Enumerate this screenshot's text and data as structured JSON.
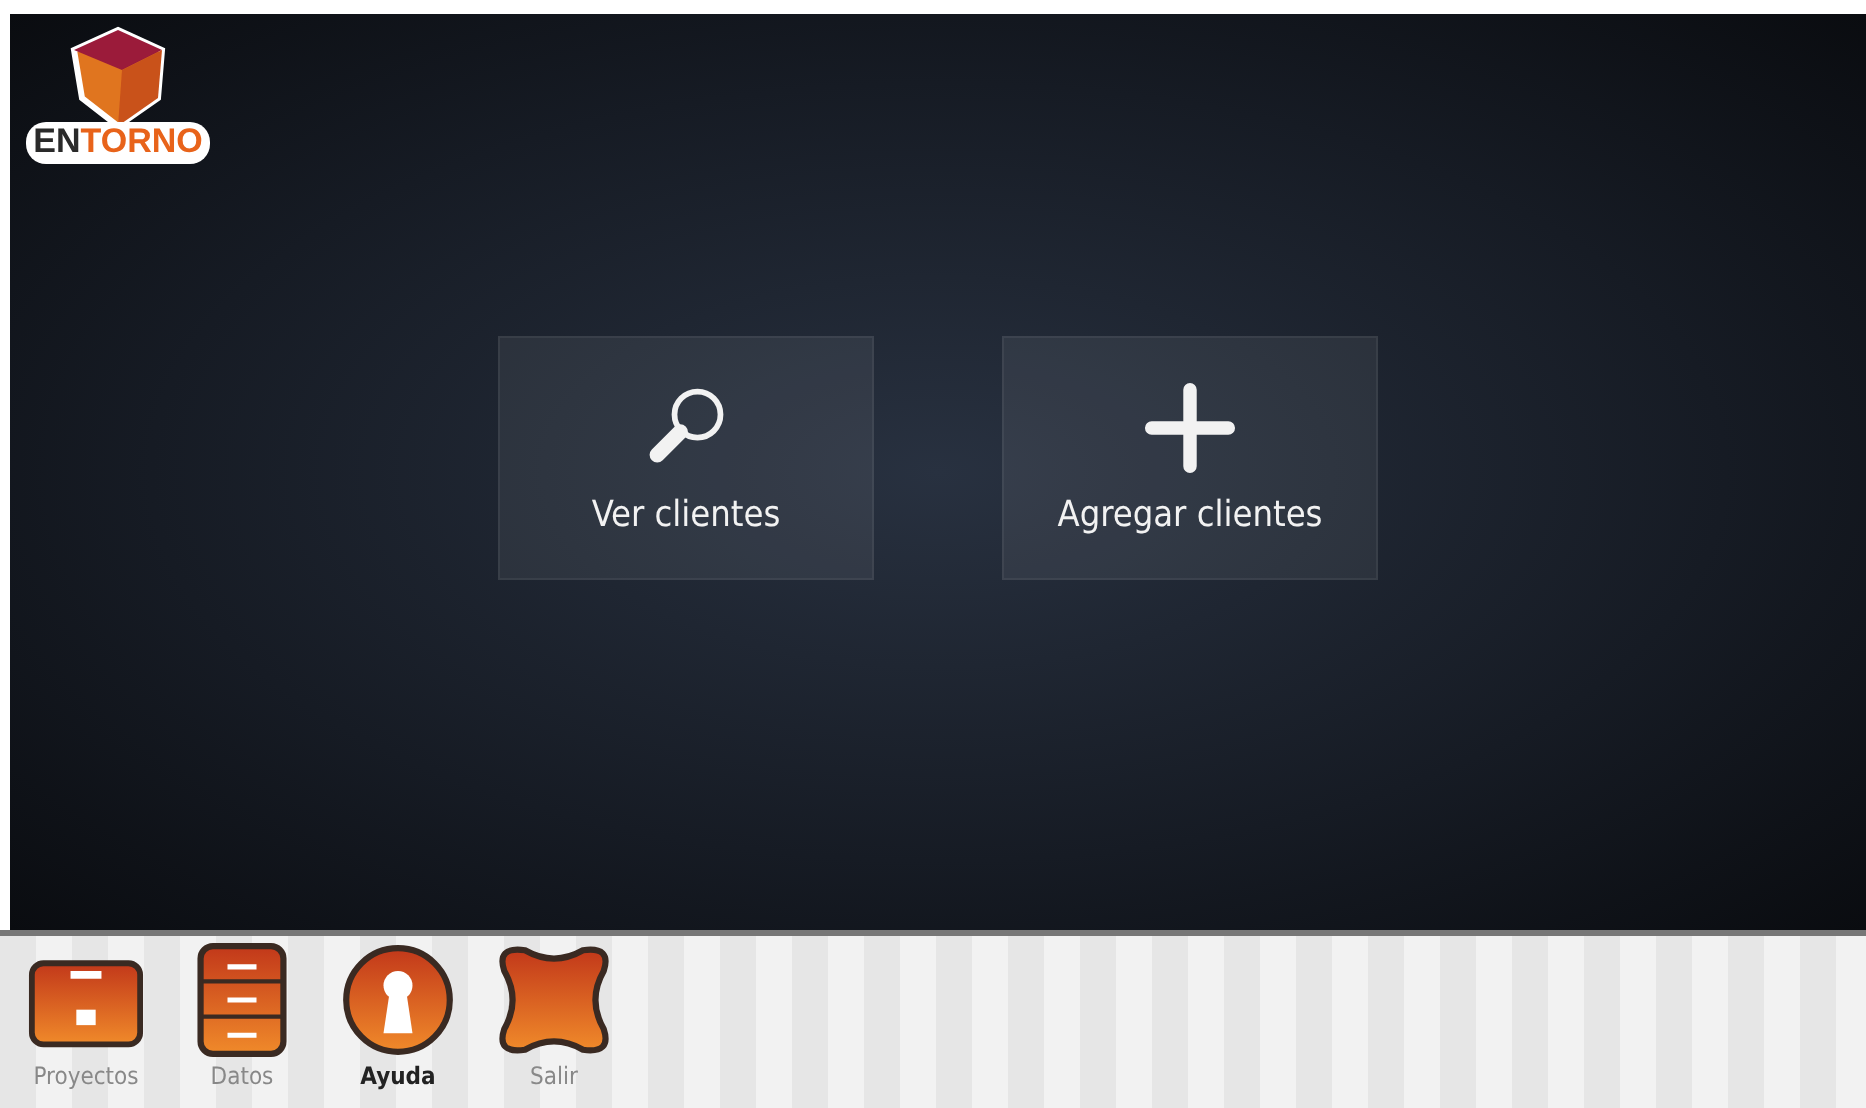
{
  "logo": {
    "part_1": "EN",
    "part_2": "TORNO"
  },
  "actions": [
    {
      "kind": "search",
      "label": "Ver clientes"
    },
    {
      "kind": "add",
      "label": "Agregar clientes"
    }
  ],
  "dock": [
    {
      "kind": "briefcase",
      "label": "Proyectos",
      "selected": false
    },
    {
      "kind": "cabinet",
      "label": "Datos",
      "selected": false
    },
    {
      "kind": "keyhole",
      "label": "Ayuda",
      "selected": true
    },
    {
      "kind": "cross",
      "label": "Salir",
      "selected": false
    }
  ]
}
